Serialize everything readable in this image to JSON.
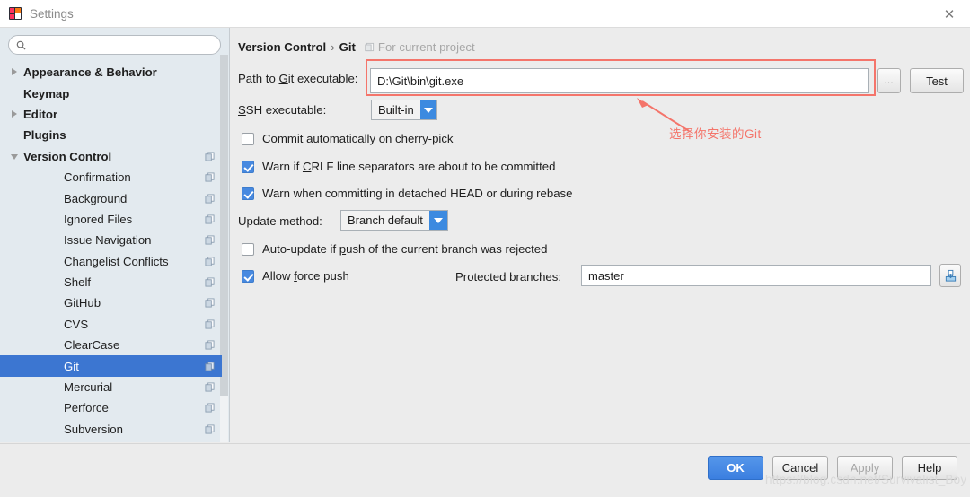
{
  "window": {
    "title": "Settings",
    "app_icon": "intellij-idea-icon",
    "close_label": "✕"
  },
  "search": {
    "value": "",
    "placeholder": "",
    "icon": "search-icon"
  },
  "sidebar": {
    "items": [
      {
        "label": "Appearance & Behavior",
        "level": "top",
        "arrow": "right",
        "copy_icon": false,
        "selected": false
      },
      {
        "label": "Keymap",
        "level": "top",
        "arrow": "none",
        "copy_icon": false,
        "selected": false
      },
      {
        "label": "Editor",
        "level": "top",
        "arrow": "right",
        "copy_icon": false,
        "selected": false
      },
      {
        "label": "Plugins",
        "level": "top",
        "arrow": "none",
        "copy_icon": false,
        "selected": false
      },
      {
        "label": "Version Control",
        "level": "top",
        "arrow": "down",
        "copy_icon": true,
        "selected": false
      },
      {
        "label": "Confirmation",
        "level": "child",
        "arrow": "none",
        "copy_icon": true,
        "selected": false
      },
      {
        "label": "Background",
        "level": "child",
        "arrow": "none",
        "copy_icon": true,
        "selected": false
      },
      {
        "label": "Ignored Files",
        "level": "child",
        "arrow": "none",
        "copy_icon": true,
        "selected": false
      },
      {
        "label": "Issue Navigation",
        "level": "child",
        "arrow": "none",
        "copy_icon": true,
        "selected": false
      },
      {
        "label": "Changelist Conflicts",
        "level": "child",
        "arrow": "none",
        "copy_icon": true,
        "selected": false
      },
      {
        "label": "Shelf",
        "level": "child",
        "arrow": "none",
        "copy_icon": true,
        "selected": false
      },
      {
        "label": "GitHub",
        "level": "child",
        "arrow": "none",
        "copy_icon": true,
        "selected": false
      },
      {
        "label": "CVS",
        "level": "child",
        "arrow": "none",
        "copy_icon": true,
        "selected": false
      },
      {
        "label": "ClearCase",
        "level": "child",
        "arrow": "none",
        "copy_icon": true,
        "selected": false
      },
      {
        "label": "Git",
        "level": "child",
        "arrow": "none",
        "copy_icon": true,
        "selected": true
      },
      {
        "label": "Mercurial",
        "level": "child",
        "arrow": "none",
        "copy_icon": true,
        "selected": false
      },
      {
        "label": "Perforce",
        "level": "child",
        "arrow": "none",
        "copy_icon": true,
        "selected": false
      },
      {
        "label": "Subversion",
        "level": "child",
        "arrow": "none",
        "copy_icon": true,
        "selected": false
      }
    ]
  },
  "breadcrumb": {
    "parent": "Version Control",
    "separator": "›",
    "current": "Git",
    "scope_icon": "project-scope-icon",
    "scope_label": "For current project"
  },
  "main": {
    "git_path": {
      "label_prefix": "Path to ",
      "label_mnemonic": "G",
      "label_suffix": "it executable:",
      "value": "D:\\Git\\bin\\git.exe",
      "browse_label": "…",
      "test_label": "Test"
    },
    "ssh": {
      "label_mnemonic": "S",
      "label_suffix": "SH executable:",
      "value": "Built-in"
    },
    "cherry_pick": {
      "label": "Commit automatically on cherry-pick",
      "checked": false
    },
    "crlf": {
      "label_prefix": "Warn if ",
      "label_mnemonic": "C",
      "label_suffix": "RLF line separators are about to be committed",
      "checked": true
    },
    "detached_head": {
      "label": "Warn when committing in detached HEAD or during rebase",
      "checked": true
    },
    "update_method": {
      "label": "Update method:",
      "value": "Branch default"
    },
    "auto_update": {
      "label_prefix": "Auto-update if ",
      "label_mnemonic": "p",
      "label_suffix": "ush of the current branch was rejected",
      "checked": false
    },
    "force_push": {
      "label_prefix": "Allow ",
      "label_mnemonic": "f",
      "label_suffix": "orce push",
      "checked": true
    },
    "protected_branches": {
      "label": "Protected branches:",
      "value": "master",
      "expand_icon": "expand-field-icon"
    }
  },
  "annotation": {
    "text": "选择你安装的Git",
    "color": "#f4746a"
  },
  "footer": {
    "ok": "OK",
    "cancel": "Cancel",
    "apply": "Apply",
    "help": "Help"
  },
  "watermark": "https://blog.csdn.net/Survivalist_Boy"
}
